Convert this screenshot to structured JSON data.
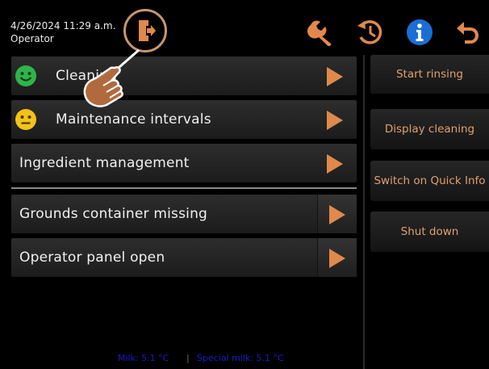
{
  "header": {
    "datetime": "4/26/2024 11:29 a.m.",
    "user_role": "Operator",
    "icons": [
      "logout-icon",
      "wrench-icon",
      "history-icon",
      "info-icon",
      "back-icon"
    ]
  },
  "menu": {
    "items": [
      {
        "label": "Cleaning",
        "status": "smiley-happy"
      },
      {
        "label": "Maintenance intervals",
        "status": "smiley-neutral"
      },
      {
        "label": "Ingredient management"
      }
    ],
    "alerts": [
      {
        "label": "Grounds container missing"
      },
      {
        "label": "Operator panel open"
      }
    ]
  },
  "side_actions": [
    {
      "label": "Start rinsing"
    },
    {
      "label": "Display cleaning"
    },
    {
      "label": "Switch on Quick Info"
    },
    {
      "label": "Shut down"
    }
  ],
  "footer": {
    "milk": "Milk: 5.1 °C",
    "separator": "|",
    "special_milk": "Special milk: 5.1 °C"
  },
  "colors": {
    "accent": "#e0894c",
    "side_text": "#e0a06d",
    "happy": "#2fb54a",
    "neutral": "#f2c318",
    "info": "#1a6fd6",
    "footer_text": "#1a1ac8"
  }
}
